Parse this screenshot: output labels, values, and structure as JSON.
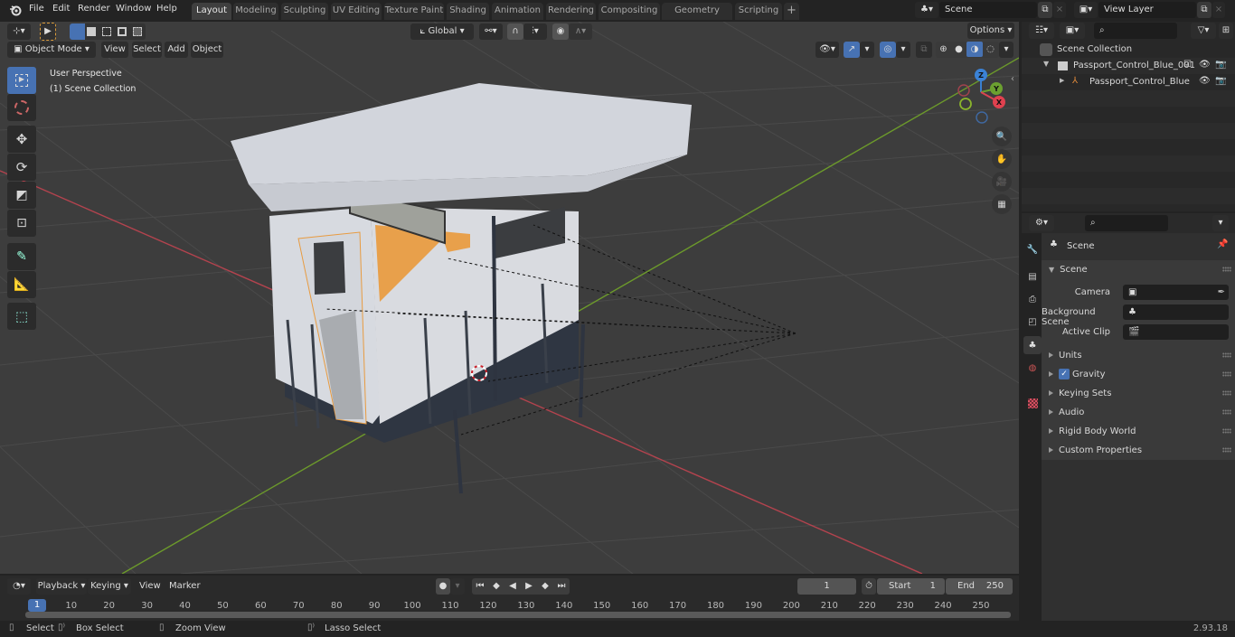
{
  "menubar": {
    "items": [
      "File",
      "Edit",
      "Render",
      "Window",
      "Help"
    ],
    "workspaces": [
      "Layout",
      "Modeling",
      "Sculpting",
      "UV Editing",
      "Texture Paint",
      "Shading",
      "Animation",
      "Rendering",
      "Compositing",
      "Geometry Nodes",
      "Scripting"
    ],
    "active_workspace": "Layout",
    "add_workspace": "+",
    "scene": "Scene",
    "view_layer": "View Layer"
  },
  "viewport_header": {
    "mode": "Object Mode",
    "menus": [
      "View",
      "Select",
      "Add",
      "Object"
    ],
    "transform_orientation": "Global",
    "options": "Options"
  },
  "viewport": {
    "overlay_line1": "User Perspective",
    "overlay_line2": "(1) Scene Collection",
    "gizmo": {
      "z": "Z",
      "y": "Y",
      "x": "X"
    },
    "colors": {
      "x_axis": "#c8414b",
      "y_axis": "#6a9a2a",
      "selection": "#f39b32",
      "grid_bg": "#3d3d3d"
    }
  },
  "toolbar": {
    "tools": [
      "select-box",
      "cursor",
      "move",
      "rotate",
      "scale",
      "transform",
      "annotate",
      "measure",
      "add-cube"
    ]
  },
  "outliner": {
    "search_placeholder": "",
    "root": "Scene Collection",
    "items": [
      {
        "name": "Passport_Control_Blue_001",
        "type": "collection",
        "expanded": true
      },
      {
        "name": "Passport_Control_Blue",
        "type": "empty",
        "expanded": false
      }
    ]
  },
  "properties": {
    "context": "Scene",
    "section": "Scene",
    "fields": [
      {
        "label": "Camera",
        "value": ""
      },
      {
        "label": "Background Scene",
        "value": ""
      },
      {
        "label": "Active Clip",
        "value": ""
      }
    ],
    "panels": [
      "Units",
      "Gravity",
      "Keying Sets",
      "Audio",
      "Rigid Body World",
      "Custom Properties"
    ],
    "gravity_checked": true
  },
  "timeline": {
    "menus": [
      "Playback",
      "Keying",
      "View",
      "Marker"
    ],
    "current_frame": "1",
    "start_label": "Start",
    "start": "1",
    "end_label": "End",
    "end": "250",
    "ticks": [
      "1",
      "10",
      "20",
      "30",
      "40",
      "50",
      "60",
      "70",
      "80",
      "90",
      "100",
      "110",
      "120",
      "130",
      "140",
      "150",
      "160",
      "170",
      "180",
      "190",
      "200",
      "210",
      "220",
      "230",
      "240",
      "250"
    ]
  },
  "statusbar": {
    "hints": [
      "Select",
      "Box Select",
      "Zoom View",
      "Lasso Select"
    ],
    "version": "2.93.18"
  }
}
